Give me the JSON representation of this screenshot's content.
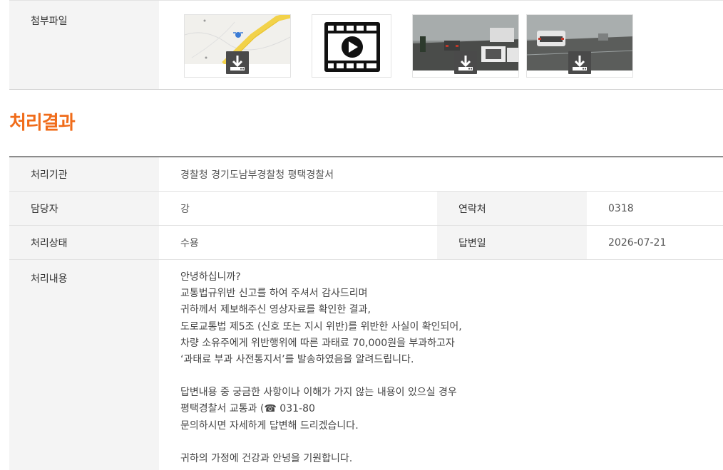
{
  "attachments": {
    "label": "첨부파일",
    "files": [
      {
        "type": "map-image",
        "icon": "download-icon"
      },
      {
        "type": "video",
        "icon": "video-play-icon"
      },
      {
        "type": "dashcam-image",
        "icon": "download-icon"
      },
      {
        "type": "dashcam-image",
        "icon": "download-icon"
      }
    ]
  },
  "result": {
    "title": "처리결과",
    "agency_label": "처리기관",
    "agency_value": "경찰청 경기도남부경찰청 평택경찰서",
    "officer_label": "담당자",
    "officer_value": "강",
    "contact_label": "연락처",
    "contact_value": "0318",
    "status_label": "처리상태",
    "status_value": "수용",
    "answer_date_label": "답변일",
    "answer_date_value": "2026-07-21",
    "content_label": "처리내용",
    "content_lines": [
      "안녕하십니까?",
      "교통법규위반 신고를 하여 주셔서 감사드리며",
      "귀하께서 제보해주신 영상자료를 확인한 결과,",
      "도로교통법 제5조 (신호 또는 지시 위반)를 위반한 사실이 확인되어,",
      "차량 소유주에게 위반행위에 따른 과태료 70,000원을 부과하고자",
      "‘과태료 부과 사전통지서’를 발송하였음을 알려드립니다.",
      "",
      "답변내용 중 궁금한 사항이나 이해가 가지 않는 내용이 있으실 경우",
      "평택경찰서 교통과 (☎ 031-80",
      "문의하시면 자세하게 답변해 드리겠습니다.",
      "",
      "귀하의 가정에 건강과 안녕을 기원합니다."
    ]
  }
}
